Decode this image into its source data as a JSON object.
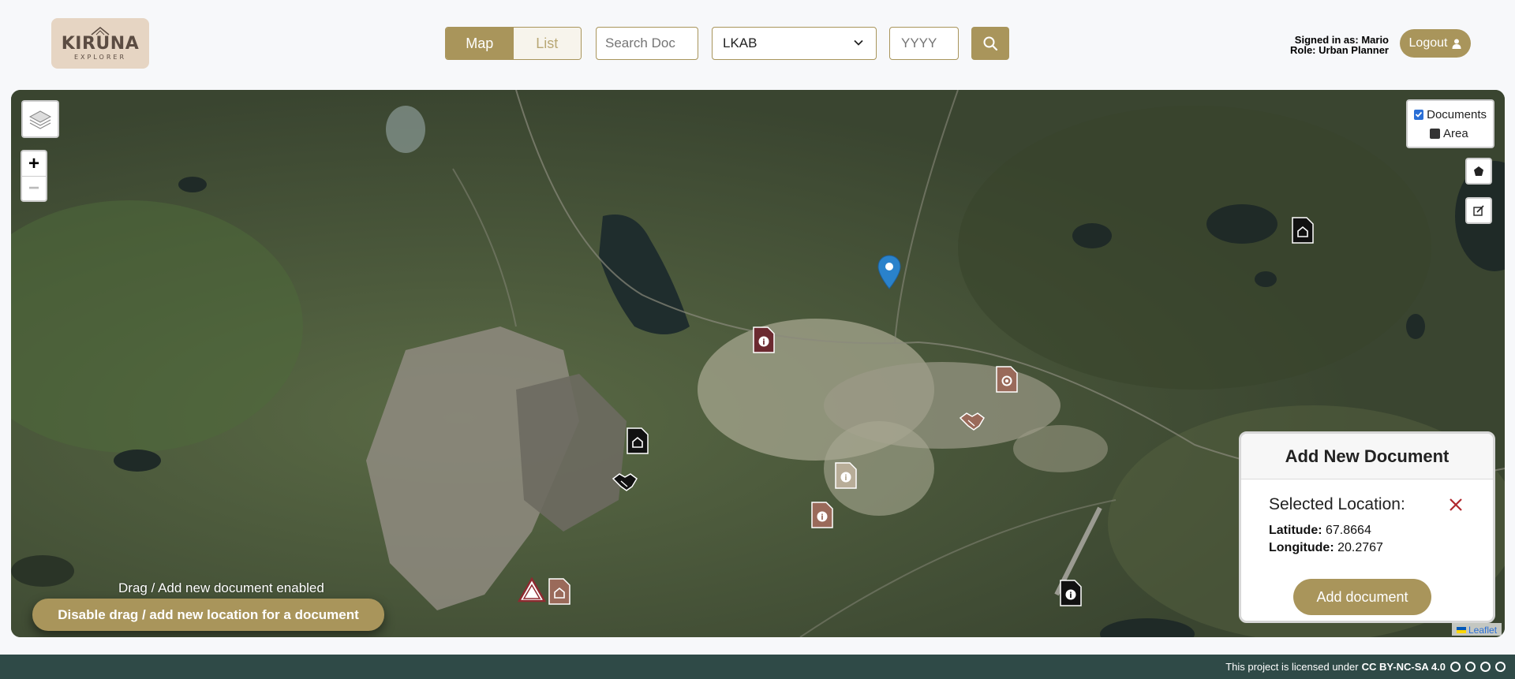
{
  "header": {
    "logo_title": "KIRUNA",
    "logo_sub": "EXPLORER",
    "view_toggle": {
      "map_label": "Map",
      "list_label": "List",
      "active": "Map"
    },
    "search": {
      "placeholder": "Search Doc"
    },
    "stakeholder_select": {
      "value": "LKAB"
    },
    "year": {
      "placeholder": "YYYY"
    },
    "user": {
      "signed_in_prefix": "Signed in as:",
      "name": "Mario",
      "role_prefix": "Role:",
      "role": "Urban Planner"
    },
    "logout_label": "Logout"
  },
  "map": {
    "overlays": [
      {
        "label": "Documents",
        "checked": true
      },
      {
        "label": "Area",
        "checked": false
      }
    ],
    "zoom_in": "+",
    "zoom_out": "−",
    "drag_status": "Drag / Add new document enabled",
    "drag_button": "Disable drag / add new location for a document",
    "attribution": "Leaflet"
  },
  "add_panel": {
    "title": "Add New Document",
    "selected_label": "Selected Location:",
    "latitude_label": "Latitude:",
    "latitude": "67.8664",
    "longitude_label": "Longitude:",
    "longitude": "20.2767",
    "add_button": "Add document"
  },
  "footer": {
    "license_text": "This project is licensed under",
    "license": "CC BY-NC-SA 4.0"
  }
}
